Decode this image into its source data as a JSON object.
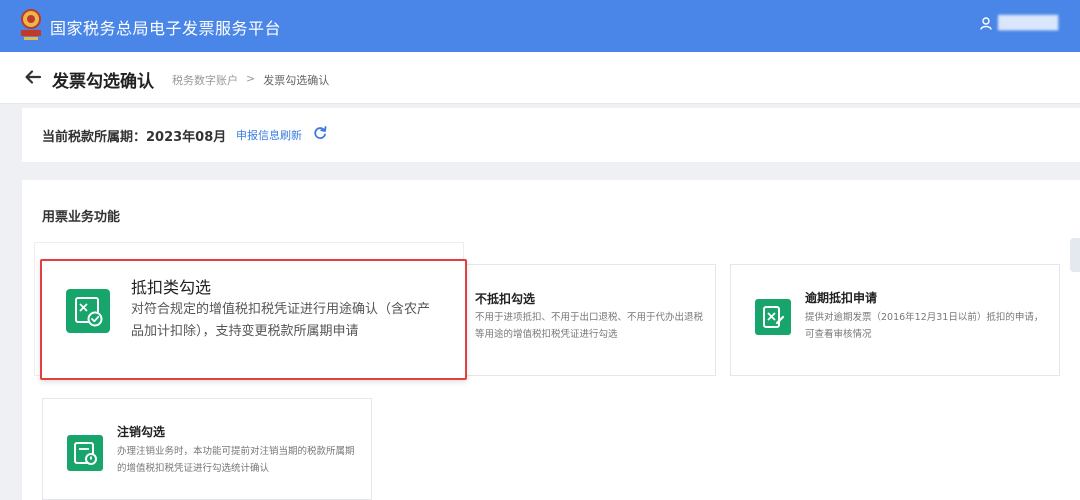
{
  "topbar": {
    "title": "国家税务总局电子发票服务平台",
    "user_name": "██████"
  },
  "header": {
    "page_title": "发票勾选确认",
    "breadcrumb": [
      "税务数字账户",
      "发票勾选确认"
    ],
    "breadcrumb_separator": ">"
  },
  "period": {
    "label": "当前税款所属期：2023年08月",
    "refresh_label": "申报信息刷新"
  },
  "functions": {
    "section_title": "用票业务功能",
    "cards": [
      {
        "title": "抵扣类勾选",
        "desc": "对符合规定的增值税扣税凭证进行用途确认（含农产品加计扣除），支持变更税款所属期申请",
        "icon": "deduction-check-icon"
      },
      {
        "title": "不抵扣勾选",
        "desc": "不用于进项抵扣、不用于出口退税、不用于代办出退税等用途的增值税扣税凭证进行勾选",
        "icon": "non-deduction-check-icon"
      },
      {
        "title": "逾期抵扣申请",
        "desc": "提供对逾期发票（2016年12月31日以前）抵扣的申请，可查看审核情况",
        "icon": "overdue-deduction-icon"
      },
      {
        "title": "注销勾选",
        "desc": "办理注销业务时，本功能可提前对注销当期的税款所属期的增值税扣税凭证进行勾选统计确认",
        "icon": "cancellation-check-icon"
      }
    ]
  },
  "zoom": {
    "title": "抵扣类勾选",
    "desc_line1": "对符合规定的增值税扣税凭证进行用途确认（含农产",
    "desc_line2": "品加计扣除），支持变更税款所属期申请"
  },
  "colors": {
    "topbar": "#4a86e8",
    "accent_green": "#17a56c",
    "link_blue": "#3b7be0",
    "highlight_red": "#e04040"
  }
}
